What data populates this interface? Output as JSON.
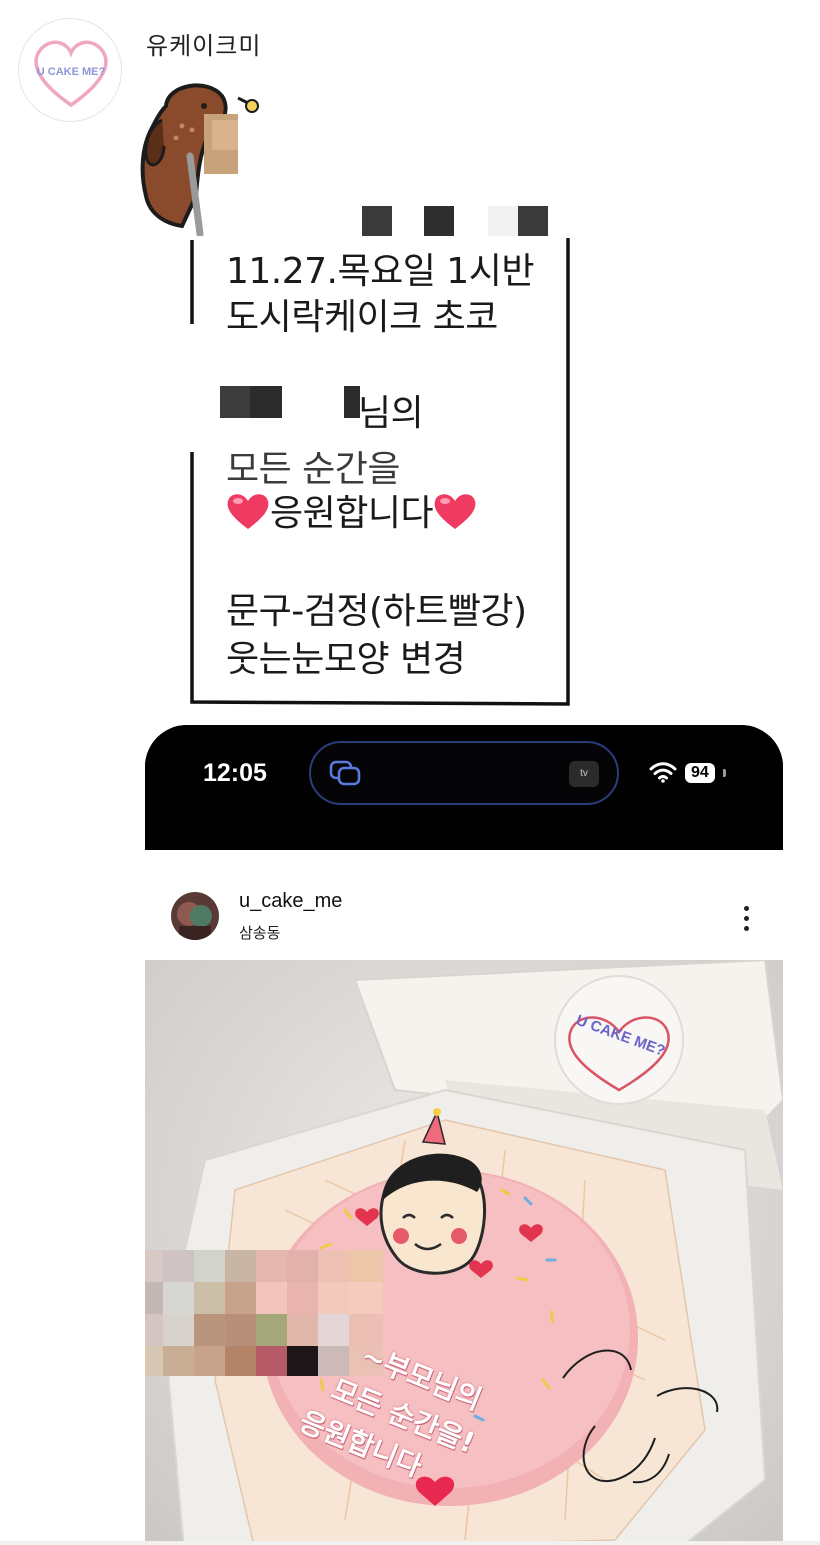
{
  "chat": {
    "sender_name": "유케이크미",
    "avatar_logo_text": "U CAKE ME?"
  },
  "memo": {
    "line1": "11.27.목요일 1시반",
    "line2": "도시락케이크 초코",
    "line3_suffix": "님의",
    "line4": "모든 순간을",
    "line5": "응원합니다",
    "line6": "문구-검정(하트빨강)",
    "line7": "웃는눈모양 변경"
  },
  "phone": {
    "time": "12:05",
    "battery": "94",
    "island_app_label": "tv"
  },
  "post": {
    "username": "u_cake_me",
    "location": "삼송동",
    "sticker_text": "U CAKE ME?",
    "cake_message_line1": "~부모님의",
    "cake_message_line2": "모든 순간을!",
    "cake_message_line3": "응원합니다"
  }
}
